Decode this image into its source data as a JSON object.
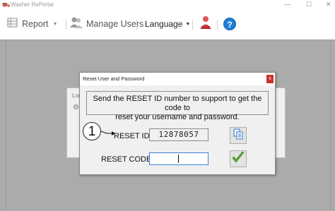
{
  "window": {
    "title": "Washer RePortal",
    "minimize": "—",
    "maximize": "☐",
    "close": "✕"
  },
  "toolbar": {
    "report_label": "Report",
    "manage_users_label": "Manage Users",
    "language_label": "Language",
    "help_glyph": "?"
  },
  "background_dialog": {
    "text": "Log"
  },
  "dialog": {
    "title": "Reset User and Password",
    "close_glyph": "x",
    "message_line1": "Send the RESET ID number to support to get the code to",
    "message_line2": "reset your username and password.",
    "annotation_number": "1",
    "reset_id_label": "RESET ID",
    "reset_id_value": "12878057",
    "reset_code_label": "RESET CODE",
    "reset_code_value": ""
  },
  "colors": {
    "accent_blue": "#1f7fd6",
    "check_green": "#5aa832",
    "close_red": "#c9302c"
  },
  "icons": [
    "app-icon",
    "report-icon",
    "users-icon",
    "user-icon",
    "help-icon",
    "copy-icon",
    "check-icon"
  ]
}
